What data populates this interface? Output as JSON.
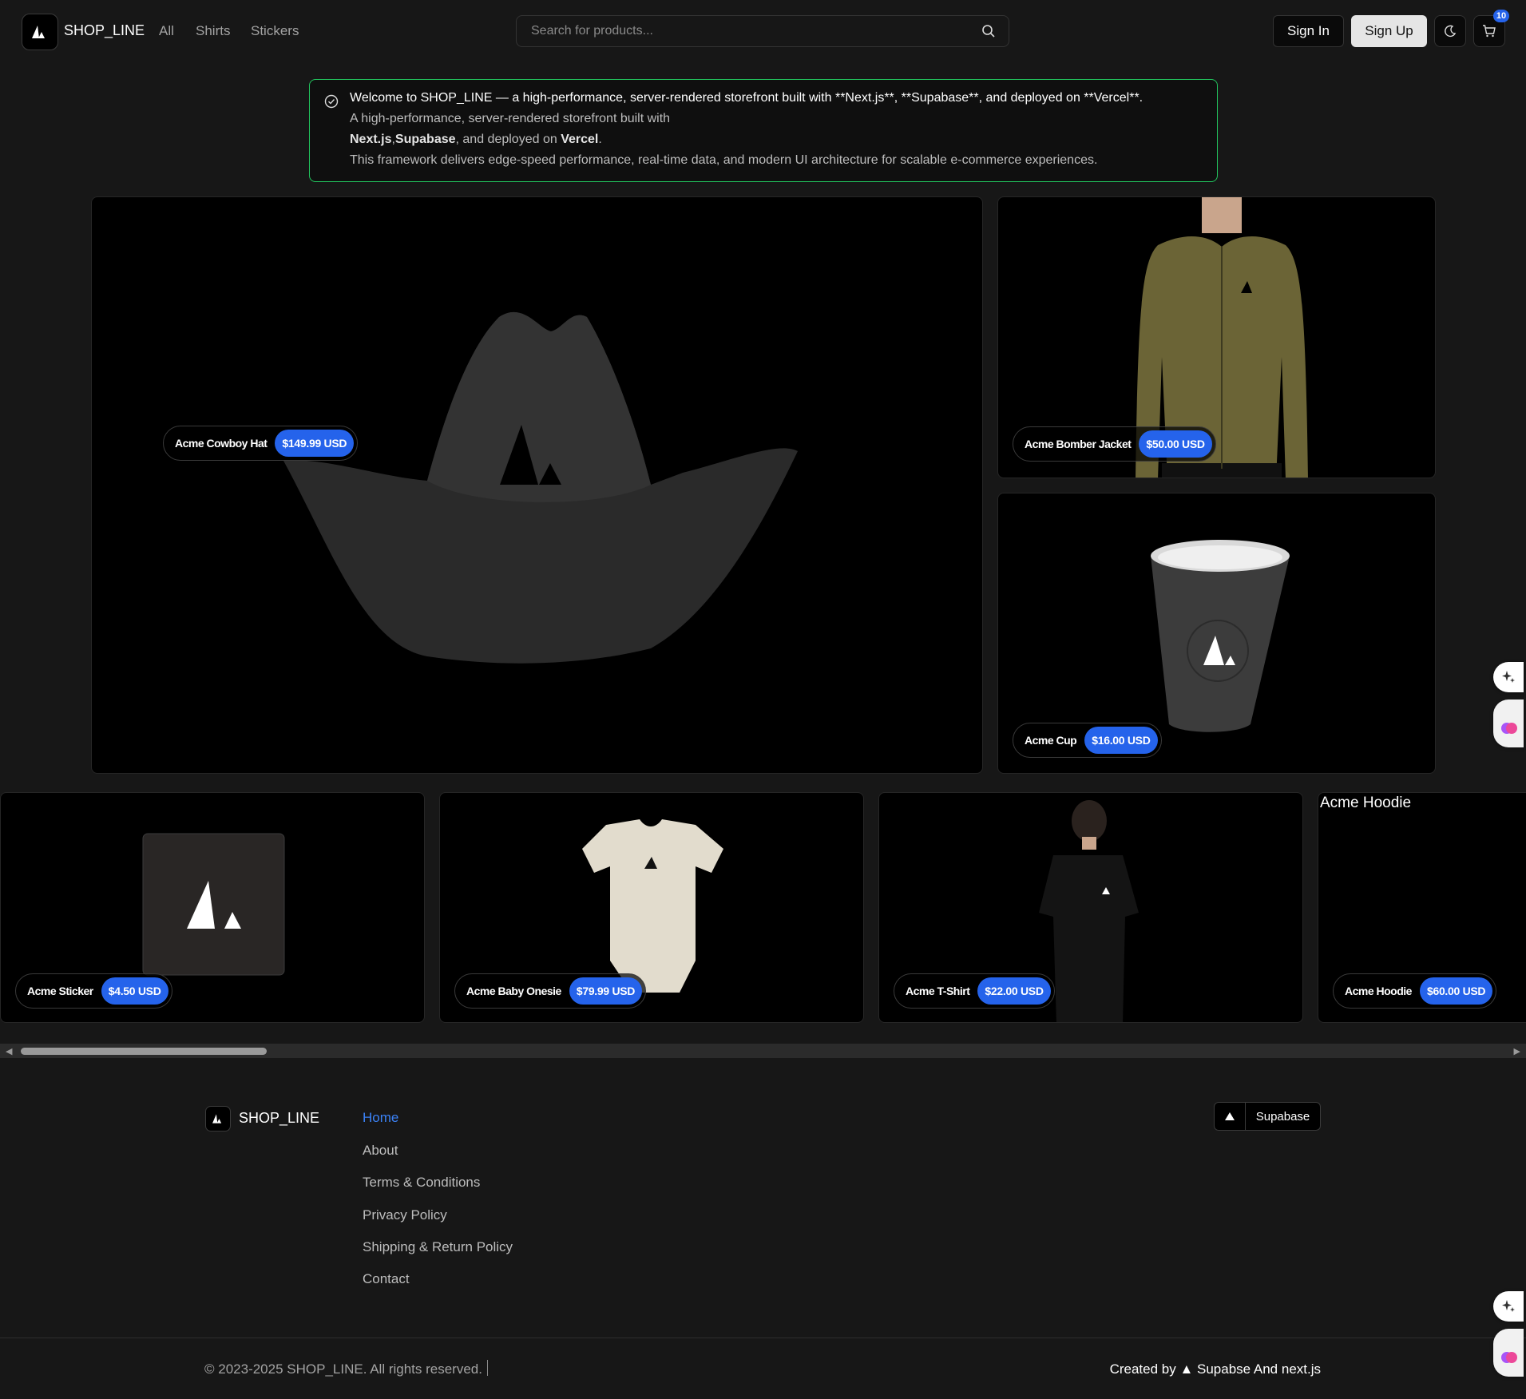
{
  "header": {
    "brand": "SHOP_LINE",
    "nav": [
      "All",
      "Shirts",
      "Stickers"
    ],
    "search_placeholder": "Search for products...",
    "sign_in": "Sign In",
    "sign_up": "Sign Up",
    "cart_count": "10"
  },
  "banner": {
    "line1": "Welcome to SHOP_LINE — a high-performance, server-rendered storefront built with **Next.js**, **Supabase**, and deployed on **Vercel**.",
    "line2": "A high-performance, server-rendered storefront built with",
    "line3_a": "Next.js",
    "line3_sep": ",",
    "line3_b": "Supabase",
    "line3_c": ", and deployed on ",
    "line3_d": "Vercel",
    "line3_e": ".",
    "line4": "This framework delivers edge-speed performance, real-time data, and modern UI architecture for scalable e-commerce experiences."
  },
  "products": {
    "hat": {
      "name": "Acme Cowboy Hat",
      "price": "$149.99 USD"
    },
    "jacket": {
      "name": "Acme Bomber Jacket",
      "price": "$50.00 USD"
    },
    "cup": {
      "name": "Acme Cup",
      "price": "$16.00 USD"
    },
    "sticker": {
      "name": "Acme Sticker",
      "price": "$4.50 USD"
    },
    "onesie": {
      "name": "Acme Baby Onesie",
      "price": "$79.99 USD"
    },
    "tshirt": {
      "name": "Acme T-Shirt",
      "price": "$22.00 USD"
    },
    "hoodie": {
      "name": "Acme Hoodie",
      "price": "$60.00 USD",
      "alt": "Acme Hoodie"
    }
  },
  "footer": {
    "brand": "SHOP_LINE",
    "links": [
      "Home",
      "About",
      "Terms & Conditions",
      "Privacy Policy",
      "Shipping & Return Policy",
      "Contact"
    ],
    "deploy_label": "Supabase",
    "copyright": "© 2023-2025 SHOP_LINE. All rights reserved.",
    "credits": "Created by ▲ Supabse And next.js"
  },
  "colors": {
    "accent": "#2563eb",
    "banner_border": "#22c55e",
    "background": "#171717"
  }
}
